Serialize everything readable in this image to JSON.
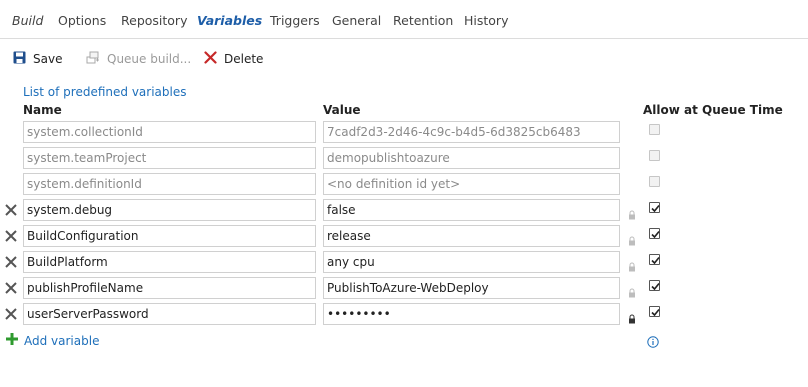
{
  "tabs": [
    {
      "label": "Build"
    },
    {
      "label": "Options"
    },
    {
      "label": "Repository"
    },
    {
      "label": "Variables"
    },
    {
      "label": "Triggers"
    },
    {
      "label": "General"
    },
    {
      "label": "Retention"
    },
    {
      "label": "History"
    }
  ],
  "active_tab": "Variables",
  "toolbar": {
    "save_label": "Save",
    "queue_label": "Queue build...",
    "delete_label": "Delete"
  },
  "links": {
    "predefined": "List of predefined variables",
    "add_variable": "Add variable"
  },
  "headers": {
    "name": "Name",
    "value": "Value",
    "allow": "Allow at Queue Time"
  },
  "system_variables": [
    {
      "name": "system.collectionId",
      "value": "7cadf2d3-2d46-4c9c-b4d5-6d3825cb6483",
      "allow_at_queue": false
    },
    {
      "name": "system.teamProject",
      "value": "demopublishtoazure",
      "allow_at_queue": false
    },
    {
      "name": "system.definitionId",
      "value": "<no definition id yet>",
      "allow_at_queue": false
    }
  ],
  "variables": [
    {
      "name": "system.debug",
      "value": "false",
      "secret": false,
      "allow_at_queue": true
    },
    {
      "name": "BuildConfiguration",
      "value": "release",
      "secret": false,
      "allow_at_queue": true
    },
    {
      "name": "BuildPlatform",
      "value": "any cpu",
      "secret": false,
      "allow_at_queue": true
    },
    {
      "name": "publishProfileName",
      "value": "PublishToAzure-WebDeploy",
      "secret": false,
      "allow_at_queue": true
    },
    {
      "name": "userServerPassword",
      "value": "•••••••••",
      "secret": true,
      "allow_at_queue": true
    }
  ],
  "colors": {
    "accent": "#1e6fba",
    "save_icon": "#1f4e8c",
    "delete_icon": "#c62828",
    "add_icon": "#2e9a2e"
  }
}
